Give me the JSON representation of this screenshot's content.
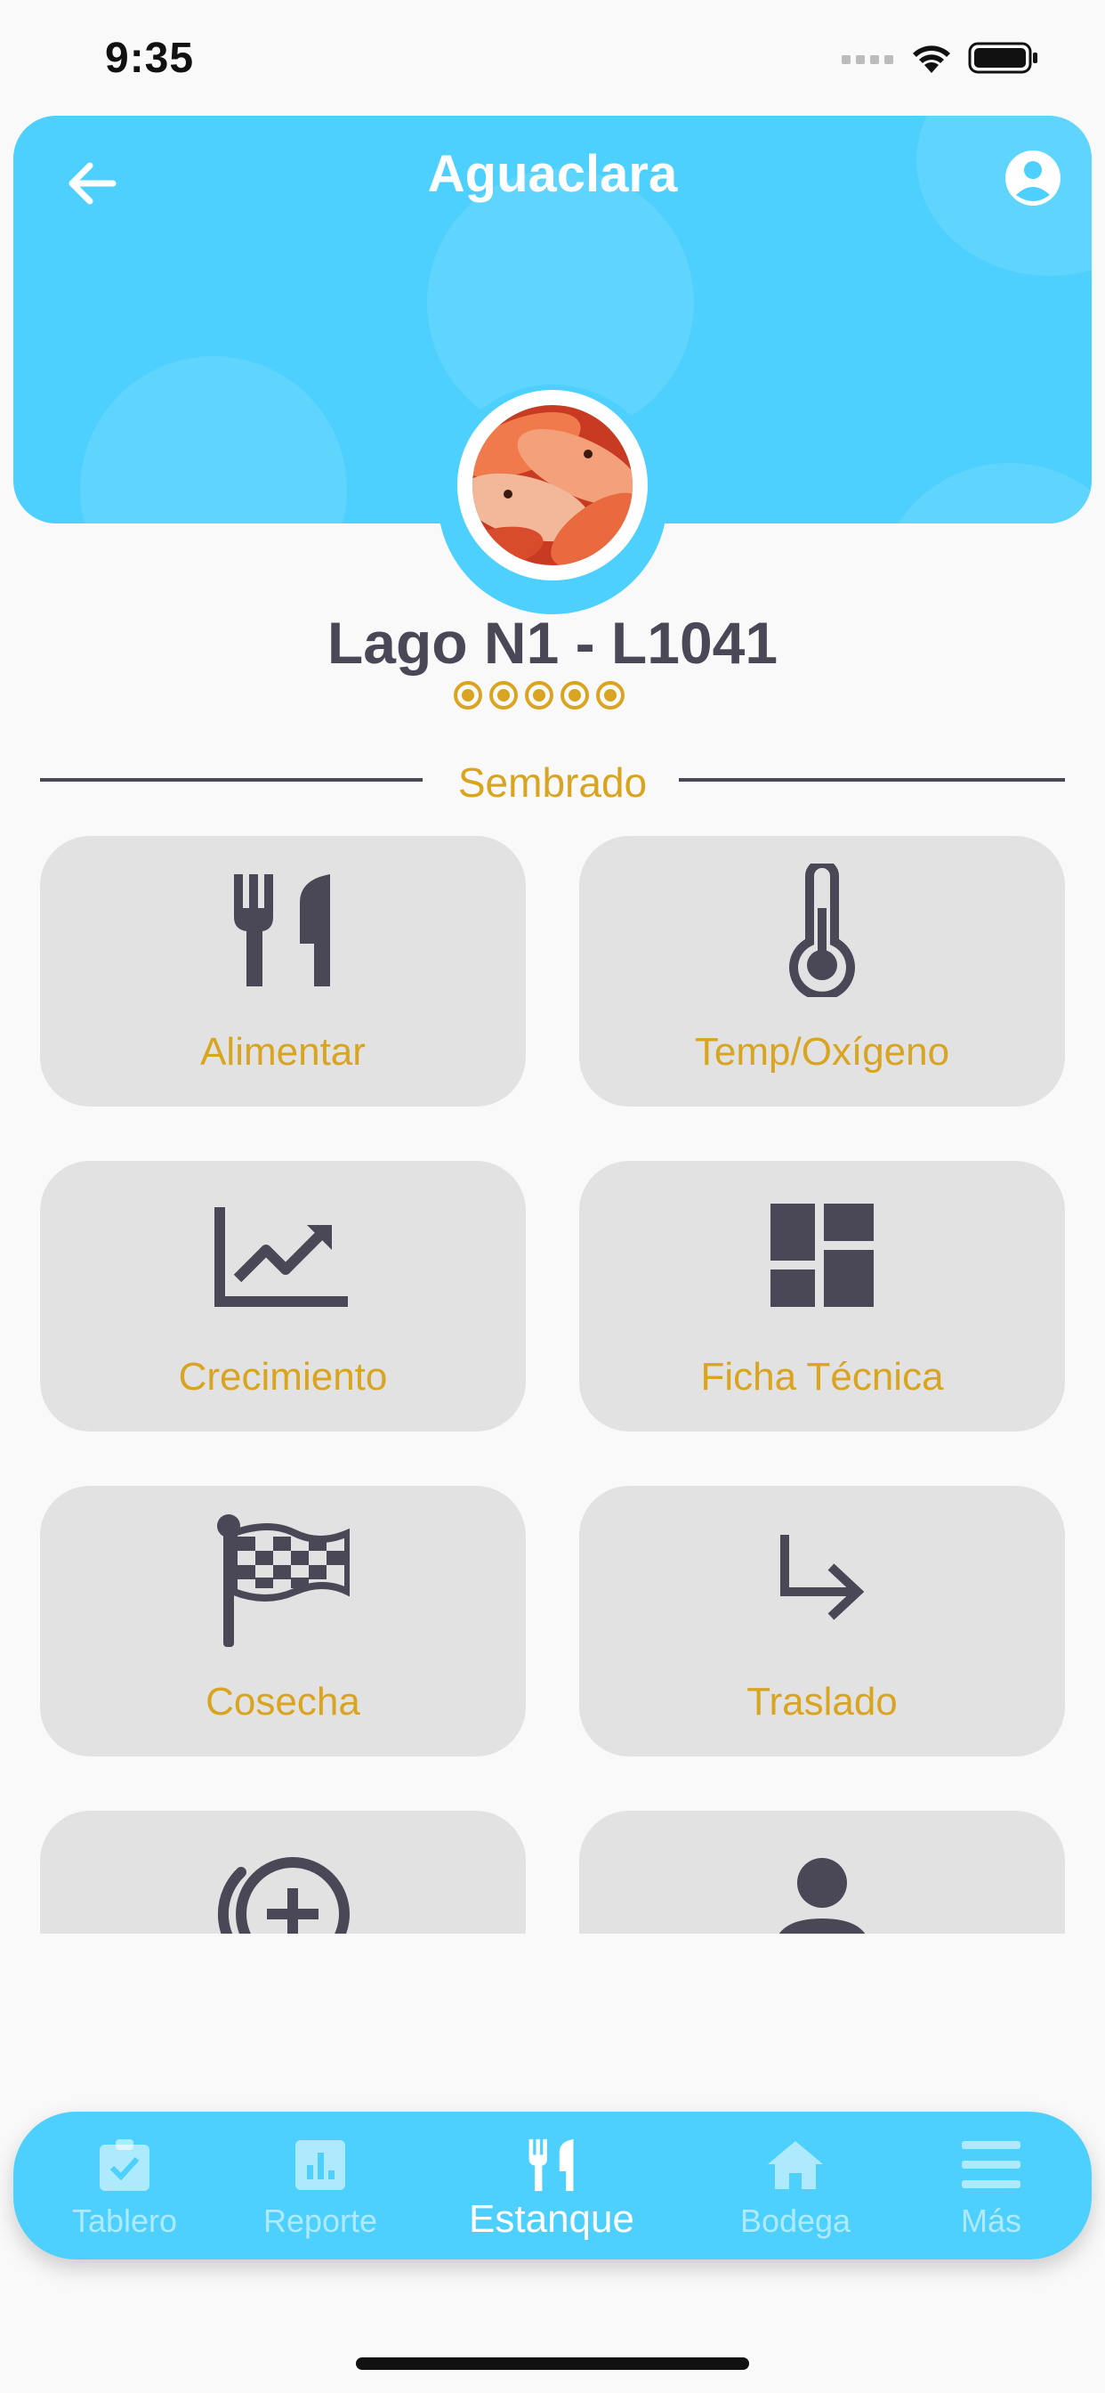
{
  "status_bar": {
    "time": "9:35"
  },
  "header": {
    "title": "Aguaclara"
  },
  "pond": {
    "name": "Lago N1 - L1041",
    "rating": {
      "value": 5,
      "max": 5
    }
  },
  "section": {
    "label": "Sembrado"
  },
  "actions": [
    {
      "label": "Alimentar",
      "icon": "fork-knife-icon"
    },
    {
      "label": "Temp/Oxígeno",
      "icon": "thermometer-icon"
    },
    {
      "label": "Crecimiento",
      "icon": "trending-up-chart-icon"
    },
    {
      "label": "Ficha Técnica",
      "icon": "dashboard-icon"
    },
    {
      "label": "Cosecha",
      "icon": "checkered-flag-icon"
    },
    {
      "label": "Traslado",
      "icon": "subdirectory-arrow-icon"
    },
    {
      "label": "",
      "icon": "add-circle-history-icon"
    },
    {
      "label": "",
      "icon": "person-icon"
    }
  ],
  "bottom_nav": {
    "items": [
      {
        "label": "Tablero",
        "icon": "clipboard-check-icon",
        "active": false
      },
      {
        "label": "Reporte",
        "icon": "bar-chart-icon",
        "active": false
      },
      {
        "label": "Estanque",
        "icon": "fork-knife-icon",
        "active": true
      },
      {
        "label": "Bodega",
        "icon": "home-icon",
        "active": false
      },
      {
        "label": "Más",
        "icon": "menu-icon",
        "active": false
      }
    ]
  },
  "colors": {
    "primary": "#4dd0fd",
    "accent": "#d9a420",
    "text_dark": "#4a4857",
    "tile_bg": "#e2e2e2",
    "background": "#f9f9f9"
  }
}
